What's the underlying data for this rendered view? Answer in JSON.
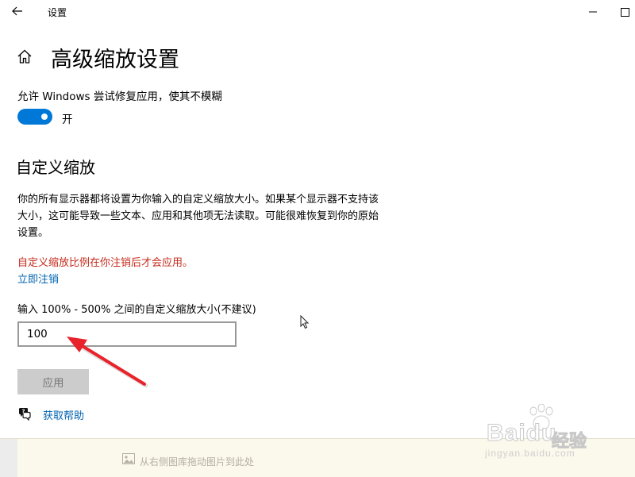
{
  "window": {
    "title": "设置",
    "back_icon": "back-arrow-icon",
    "minimize_icon": "minimize-icon",
    "maximize_icon": "maximize-icon"
  },
  "page": {
    "title": "高级缩放设置",
    "home_icon": "home-icon"
  },
  "blur_fix": {
    "label": "允许 Windows 尝试修复应用，使其不模糊",
    "state_label": "开",
    "enabled": true,
    "accent_color": "#0078d7"
  },
  "custom_scaling": {
    "heading": "自定义缩放",
    "description": "你的所有显示器都将设置为你输入的自定义缩放大小。如果某个显示器不支持该大小，这可能导致一些文本、应用和其他项无法读取。可能很难恢复到你的原始设置。",
    "warning": "自定义缩放比例在你注销后才会应用。",
    "warning_color": "#c42b1c",
    "signout_link": "立即注销",
    "input_label": "输入 100% - 500% 之间的自定义缩放大小(不建议)",
    "input_value": "100",
    "apply_button": "应用",
    "apply_enabled": false
  },
  "help": {
    "label": "获取帮助",
    "icon": "help-chat-icon"
  },
  "bottom_panel": {
    "drop_hint": "从右侧图库拖动图片到此处",
    "icon": "image-icon"
  },
  "watermark": {
    "brand": "Baidu",
    "sub": "经验",
    "url": "jingyan.baidu.com"
  },
  "annotations": {
    "arrow_color": "#e8232b"
  }
}
